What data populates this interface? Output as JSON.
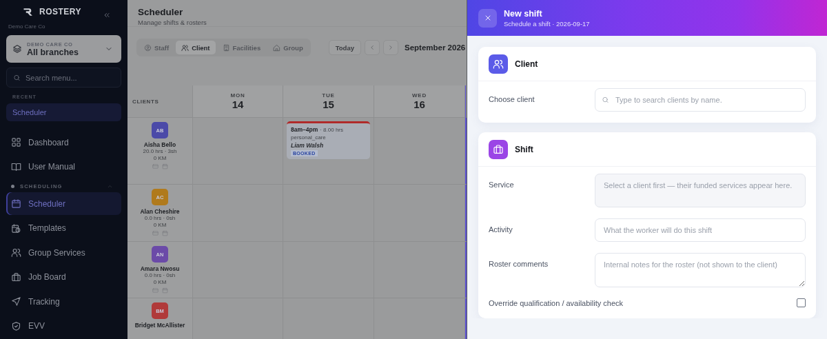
{
  "sidebar": {
    "brand": "ROSTERY",
    "org": "Demo Care Co",
    "branch_picker": {
      "caption": "DEMO CARE CO",
      "value": "All branches"
    },
    "search": {
      "placeholder": "Search menu..."
    },
    "recent": {
      "heading": "RECENT",
      "items": [
        {
          "label": "Scheduler",
          "selected": true
        }
      ]
    },
    "items": [
      {
        "label": "Dashboard",
        "selected": false
      },
      {
        "label": "User Manual",
        "selected": false
      }
    ],
    "sections": [
      {
        "heading": "SCHEDULING",
        "expanded": true,
        "items": [
          {
            "label": "Scheduler",
            "selected": true
          },
          {
            "label": "Templates",
            "selected": false
          },
          {
            "label": "Group Services",
            "selected": false
          },
          {
            "label": "Job Board",
            "selected": false
          },
          {
            "label": "Tracking",
            "selected": false
          },
          {
            "label": "EVV",
            "selected": false
          }
        ]
      }
    ]
  },
  "header": {
    "title": "Scheduler",
    "subtitle": "Manage shifts & rosters"
  },
  "view_tabs": [
    {
      "label": "Staff",
      "selected": false
    },
    {
      "label": "Client",
      "selected": true
    },
    {
      "label": "Facilities",
      "selected": false
    },
    {
      "label": "Group",
      "selected": false
    }
  ],
  "today_button": "Today",
  "period": "September 2026",
  "calendar": {
    "corner": "CLIENTS",
    "days": [
      {
        "weekday": "MON",
        "date": "14"
      },
      {
        "weekday": "TUE",
        "date": "15"
      },
      {
        "weekday": "WED",
        "date": "16"
      }
    ],
    "rows": [
      {
        "initials": "AB",
        "name": "Aisha Bello",
        "color": "#4b4aa8",
        "hours": "20.0 hrs · 3sh",
        "distance": "0 KM",
        "cells": [
          null,
          {
            "time": "8am–4pm",
            "hours": "· 8.00 hrs",
            "service": "personal_care",
            "worker": "Liam Walsh",
            "status": "BOOKED"
          },
          null
        ]
      },
      {
        "initials": "AC",
        "name": "Alan Cheshire",
        "color": "#b07a1c",
        "hours": "0.0 hrs · 0sh",
        "distance": "0 KM",
        "cells": [
          null,
          null,
          null
        ]
      },
      {
        "initials": "AN",
        "name": "Amara Nwosu",
        "color": "#6b4aa8",
        "hours": "0.0 hrs · 0sh",
        "distance": "0 KM",
        "cells": [
          null,
          null,
          null
        ]
      },
      {
        "initials": "BM",
        "name": "Bridget McAllister",
        "color": "#b03a3a",
        "cells": [
          null,
          null,
          null
        ]
      }
    ]
  },
  "drawer": {
    "title": "New shift",
    "subtitle": "Schedule a shift · 2026-09-17",
    "sections": [
      {
        "title": "Client",
        "fields": [
          {
            "kind": "search",
            "label": "Choose client",
            "placeholder": "Type to search clients by name."
          }
        ]
      },
      {
        "title": "Shift",
        "fields": [
          {
            "kind": "disabled",
            "label": "Service",
            "placeholder": "Select a client first — their funded services appear here."
          },
          {
            "kind": "text",
            "label": "Activity",
            "placeholder": "What the worker will do this shift"
          },
          {
            "kind": "textarea",
            "label": "Roster comments",
            "placeholder": "Internal notes for the roster (not shown to the client)"
          },
          {
            "kind": "checkbox",
            "label": "Override qualification / availability check",
            "checked": false
          }
        ]
      }
    ]
  }
}
